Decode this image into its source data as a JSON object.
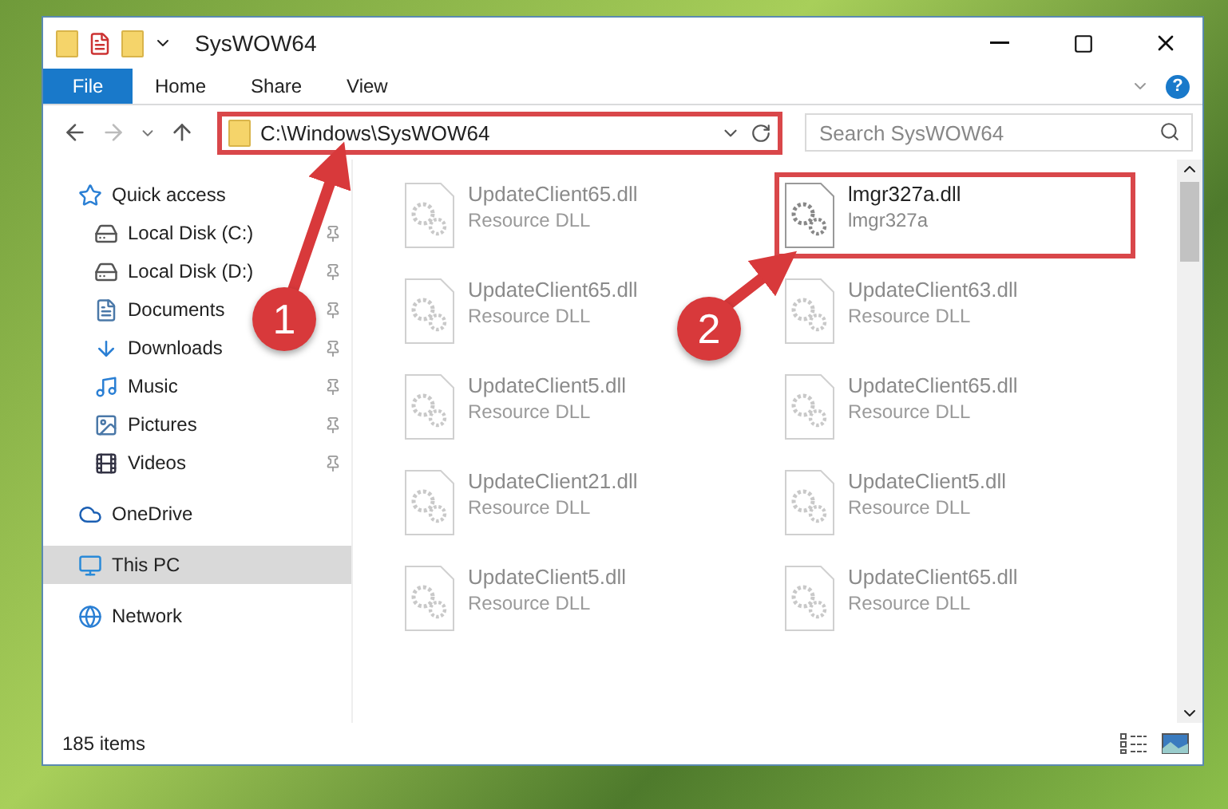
{
  "window": {
    "title": "SysWOW64"
  },
  "ribbon_tabs": [
    {
      "label": "File",
      "selected": true
    },
    {
      "label": "Home",
      "selected": false
    },
    {
      "label": "Share",
      "selected": false
    },
    {
      "label": "View",
      "selected": false
    }
  ],
  "help": {
    "label": "?"
  },
  "address_bar": {
    "path": "C:\\Windows\\SysWOW64",
    "highlighted": true
  },
  "search": {
    "placeholder": "Search SysWOW64"
  },
  "sidebar": {
    "items": [
      {
        "label": "Quick access",
        "kind": "quick",
        "selected": false,
        "children": [
          {
            "label": "Local Disk (C:)",
            "kind": "diskc",
            "pinned": true
          },
          {
            "label": "Local Disk (D:)",
            "kind": "disk",
            "pinned": true
          },
          {
            "label": "Documents",
            "kind": "docs",
            "pinned": true
          },
          {
            "label": "Downloads",
            "kind": "downloads",
            "pinned": true
          },
          {
            "label": "Music",
            "kind": "music",
            "pinned": true
          },
          {
            "label": "Pictures",
            "kind": "pictures",
            "pinned": true
          },
          {
            "label": "Videos",
            "kind": "videos",
            "pinned": true
          }
        ]
      },
      {
        "label": "OneDrive",
        "kind": "cloud",
        "selected": false
      },
      {
        "label": "This PC",
        "kind": "pc",
        "selected": true
      },
      {
        "label": "Network",
        "kind": "network",
        "selected": false
      }
    ]
  },
  "files": [
    {
      "name": "UpdateClient65.dll",
      "type": "Resource DLL",
      "highlighted": false
    },
    {
      "name": "lmgr327a.dll",
      "type": "lmgr327a",
      "highlighted": true
    },
    {
      "name": "UpdateClient65.dll",
      "type": "Resource DLL",
      "highlighted": false
    },
    {
      "name": "UpdateClient63.dll",
      "type": "Resource DLL",
      "highlighted": false
    },
    {
      "name": "UpdateClient5.dll",
      "type": "Resource DLL",
      "highlighted": false
    },
    {
      "name": "UpdateClient65.dll",
      "type": "Resource DLL",
      "highlighted": false
    },
    {
      "name": "UpdateClient21.dll",
      "type": "Resource DLL",
      "highlighted": false
    },
    {
      "name": "UpdateClient5.dll",
      "type": "Resource DLL",
      "highlighted": false
    },
    {
      "name": "UpdateClient5.dll",
      "type": "Resource DLL",
      "highlighted": false
    },
    {
      "name": "UpdateClient65.dll",
      "type": "Resource DLL",
      "highlighted": false
    }
  ],
  "status_bar": {
    "count": "185 items"
  },
  "callouts": [
    {
      "number": "1"
    },
    {
      "number": "2"
    }
  ]
}
